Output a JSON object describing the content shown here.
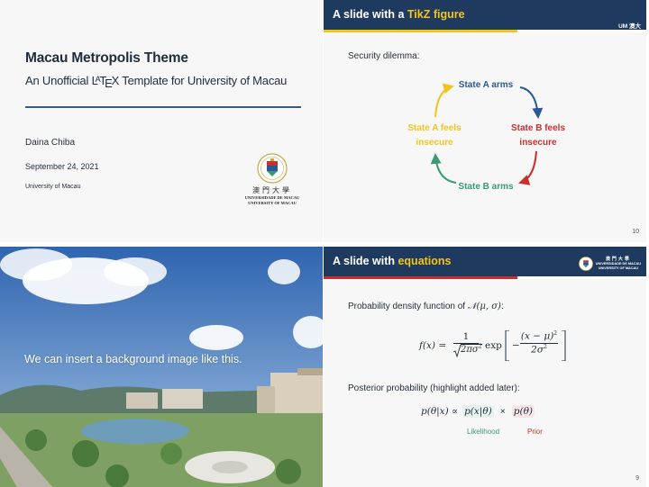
{
  "slide1": {
    "title": "Macau Metropolis Theme",
    "subtitle_pre": "An Unofficial ",
    "latex_l": "L",
    "latex_a": "A",
    "latex_t": "T",
    "latex_e": "E",
    "latex_x": "X",
    "subtitle_post": " Template for University of Macau",
    "author": "Daina Chiba",
    "date": "September 24, 2021",
    "institute": "University of Macau",
    "logo_cn": "澳門大學",
    "logo_pt": "UNIVERSIDADE DE MACAU",
    "logo_en": "UNIVERSITY OF MACAU"
  },
  "slide2": {
    "title_pre": "A slide with a ",
    "title_hl": "TikZ figure",
    "header_mark": "UM 澳大",
    "intro": "Security dilemma:",
    "node_top": "State A arms",
    "node_right_1": "State B feels",
    "node_right_2": "insecure",
    "node_bottom": "State B arms",
    "node_left_1": "State A feels",
    "node_left_2": "insecure",
    "page": "10",
    "colors": {
      "blue": "#2a5a96",
      "red": "#c9302c",
      "green": "#3a9a75",
      "yellow": "#f2c41d"
    }
  },
  "slide3": {
    "text": "We can insert a background image like this."
  },
  "slide4": {
    "title_pre": "A slide with ",
    "title_hl": "equations",
    "logo_cn": "澳門大學",
    "logo_pt": "UNIVERSIDADE DE MACAU",
    "logo_en": "UNIVERSITY OF MACAU",
    "intro_pre": "Probability density function of ",
    "intro_math": "𝒩(μ, σ)",
    "intro_post": ":",
    "eq_lhs": "f(x) =",
    "eq_num": "1",
    "eq_den": "2πσ",
    "eq_exp": "exp",
    "eq_in_num": "(x − μ)",
    "eq_in_den": "2σ",
    "eq_minus": "−",
    "sup2": "2",
    "posterior_intro": "Posterior probability (highlight added later):",
    "post_lhs": "p(θ|x) ∝",
    "likelihood": "p(x|θ)",
    "times": "×",
    "prior": "p(θ)",
    "likelihood_label": "Likelihood",
    "prior_label": "Prior",
    "page": "9",
    "colors": {
      "likelihood": "#3a9a75",
      "prior": "#c9302c"
    }
  }
}
